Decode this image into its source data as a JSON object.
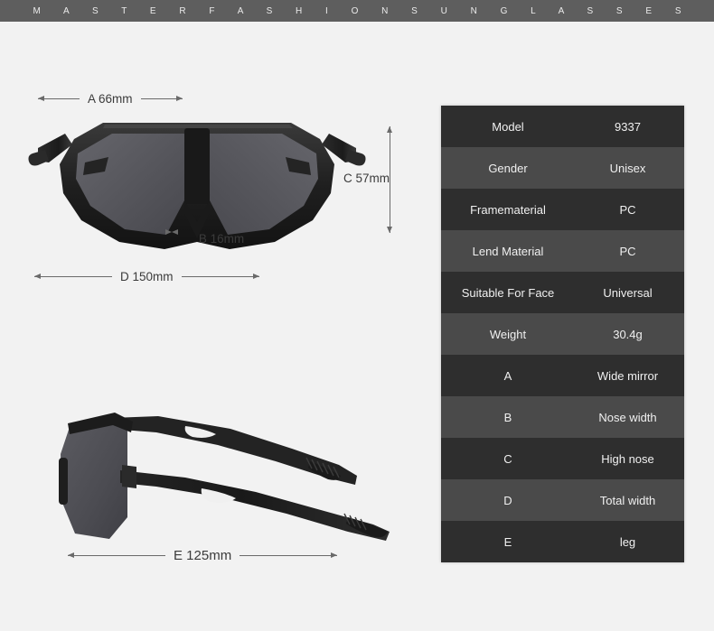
{
  "banner": {
    "text": "M A S T E R F A S H I O N S U N G L A S S E S",
    "background_color": "#5e5e5e",
    "text_color": "#ebebeb"
  },
  "page": {
    "background_color": "#f2f2f2"
  },
  "dimensions": {
    "a": {
      "label": "A 66mm",
      "letter": "A",
      "value": "66mm",
      "orientation": "horizontal",
      "measures": "Wide mirror"
    },
    "b": {
      "label": "B 16mm",
      "letter": "B",
      "value": "16mm",
      "orientation": "horizontal",
      "measures": "Nose width"
    },
    "c": {
      "label": "C 57mm",
      "letter": "C",
      "value": "57mm",
      "orientation": "vertical",
      "measures": "High nose"
    },
    "d": {
      "label": "D 150mm",
      "letter": "D",
      "value": "150mm",
      "orientation": "horizontal",
      "measures": "Total width"
    },
    "e": {
      "label": "E 125mm",
      "letter": "E",
      "value": "125mm",
      "orientation": "horizontal",
      "measures": "leg"
    }
  },
  "product_images": {
    "front": {
      "name": "sunglasses-front-view",
      "frame_color": "#1d1d1d",
      "lens_color": "#5a5a60"
    },
    "side": {
      "name": "sunglasses-side-view",
      "frame_color": "#1d1d1d",
      "lens_color": "#4e4e54"
    }
  },
  "spec_table": {
    "row_color_odd": "#2e2e2e",
    "row_color_even": "#4a4a4a",
    "text_color": "#f0f0f0",
    "rows": [
      {
        "key": "Model",
        "value": "9337"
      },
      {
        "key": "Gender",
        "value": "Unisex"
      },
      {
        "key": "Framematerial",
        "value": "PC"
      },
      {
        "key": "Lend Material",
        "value": "PC"
      },
      {
        "key": "Suitable For Face",
        "value": "Universal"
      },
      {
        "key": "Weight",
        "value": "30.4g"
      },
      {
        "key": "A",
        "value": "Wide mirror"
      },
      {
        "key": "B",
        "value": "Nose width"
      },
      {
        "key": "C",
        "value": "High nose"
      },
      {
        "key": "D",
        "value": "Total width"
      },
      {
        "key": "E",
        "value": "leg"
      }
    ]
  }
}
